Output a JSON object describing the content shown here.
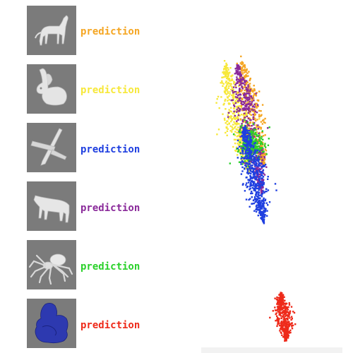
{
  "rows": [
    {
      "shape": "horse-icon",
      "label": "prediction",
      "color": "#f5a623"
    },
    {
      "shape": "rabbit-icon",
      "label": "prediction",
      "color": "#f7e83a"
    },
    {
      "shape": "airplane-icon",
      "label": "prediction",
      "color": "#1f3fe0"
    },
    {
      "shape": "cow-icon",
      "label": "prediction",
      "color": "#8a2a9a"
    },
    {
      "shape": "spider-icon",
      "label": "prediction",
      "color": "#2ad12a"
    },
    {
      "shape": "blob-icon",
      "label": "prediction",
      "color": "#ee2a1a"
    }
  ],
  "blob_color": "#2d39b0"
}
